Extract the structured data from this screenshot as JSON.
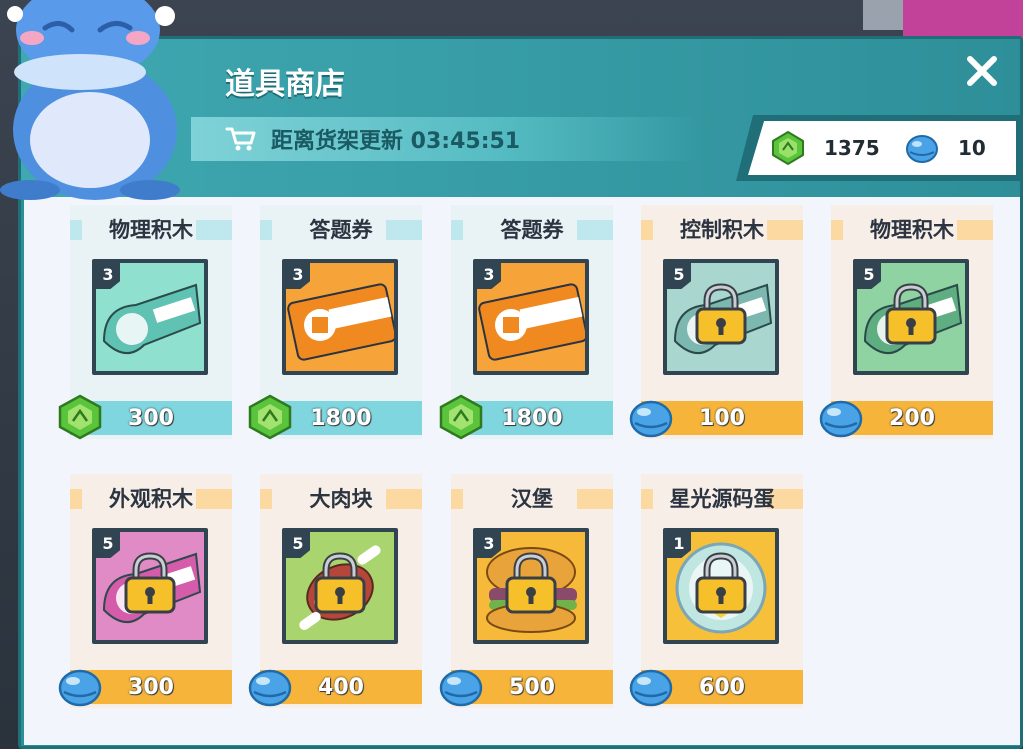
{
  "shop": {
    "title": "道具商店",
    "timer_label": "距离货架更新 03:45:51"
  },
  "currency": {
    "gems": "1375",
    "bells": "10"
  },
  "items": [
    {
      "name": "物理积木",
      "qty": "3",
      "price": "300",
      "currency": "gem",
      "locked": false,
      "theme": "teal",
      "art": "physics"
    },
    {
      "name": "答题券",
      "qty": "3",
      "price": "1800",
      "currency": "gem",
      "locked": false,
      "theme": "teal",
      "art": "ticket"
    },
    {
      "name": "答题券",
      "qty": "3",
      "price": "1800",
      "currency": "gem",
      "locked": false,
      "theme": "teal",
      "art": "ticket"
    },
    {
      "name": "控制积木",
      "qty": "5",
      "price": "100",
      "currency": "bell",
      "locked": true,
      "theme": "peach",
      "art": "control"
    },
    {
      "name": "物理积木",
      "qty": "5",
      "price": "200",
      "currency": "bell",
      "locked": true,
      "theme": "peach",
      "art": "physics-green"
    },
    {
      "name": "外观积木",
      "qty": "5",
      "price": "300",
      "currency": "bell",
      "locked": true,
      "theme": "peach",
      "art": "looks"
    },
    {
      "name": "大肉块",
      "qty": "5",
      "price": "400",
      "currency": "bell",
      "locked": true,
      "theme": "peach",
      "art": "meat"
    },
    {
      "name": "汉堡",
      "qty": "3",
      "price": "500",
      "currency": "bell",
      "locked": true,
      "theme": "peach",
      "art": "burger"
    },
    {
      "name": "星光源码蛋",
      "qty": "1",
      "price": "600",
      "currency": "bell",
      "locked": true,
      "theme": "peach",
      "art": "egg"
    }
  ],
  "icons": {
    "close": "close-icon",
    "cart": "cart-icon",
    "gem": "green-gem-icon",
    "bell": "blue-bell-icon",
    "lock": "padlock-icon"
  },
  "colors": {
    "panel": "#2b8f98",
    "teal_price": "#7fd6df",
    "gold_price": "#f6b53a"
  }
}
